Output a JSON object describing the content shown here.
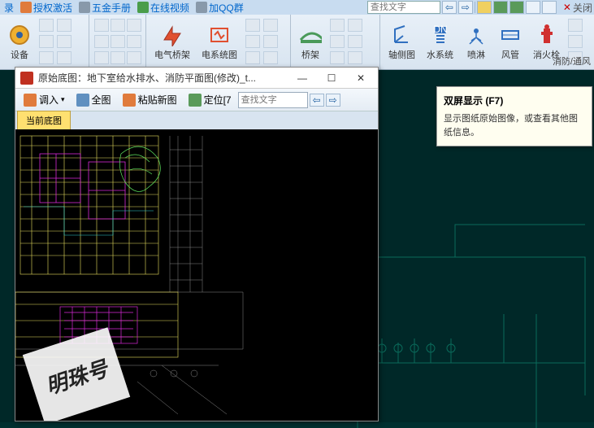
{
  "topmenu": {
    "items": [
      "录",
      "授权激活",
      "五金手册",
      "在线视频",
      "加QQ群"
    ],
    "search_ph": "查找文字",
    "close": "关闭"
  },
  "ribbon": {
    "group1": {
      "label": "设备"
    },
    "group2": {
      "labels": [
        "电气桥架",
        "电系统图"
      ]
    },
    "group3": {
      "label": "桥架"
    },
    "group4": {
      "labels": [
        "轴侧图",
        "水系统",
        "喷淋",
        "风管",
        "消火栓"
      ]
    },
    "tab": "消防/通风"
  },
  "popup": {
    "title": "原始底图：地下室给水排水、消防平面图(修改)_t...",
    "toolbar": {
      "import": "调入",
      "full": "全图",
      "paste": "粘贴新图",
      "locate": "定位[7",
      "search_ph": "查找文字"
    },
    "tab": "当前底图"
  },
  "tooltip": {
    "title": "双屏显示 (F7)",
    "body": "显示图纸原始图像，或查看其他图纸信息。"
  },
  "watermark": "明珠号"
}
